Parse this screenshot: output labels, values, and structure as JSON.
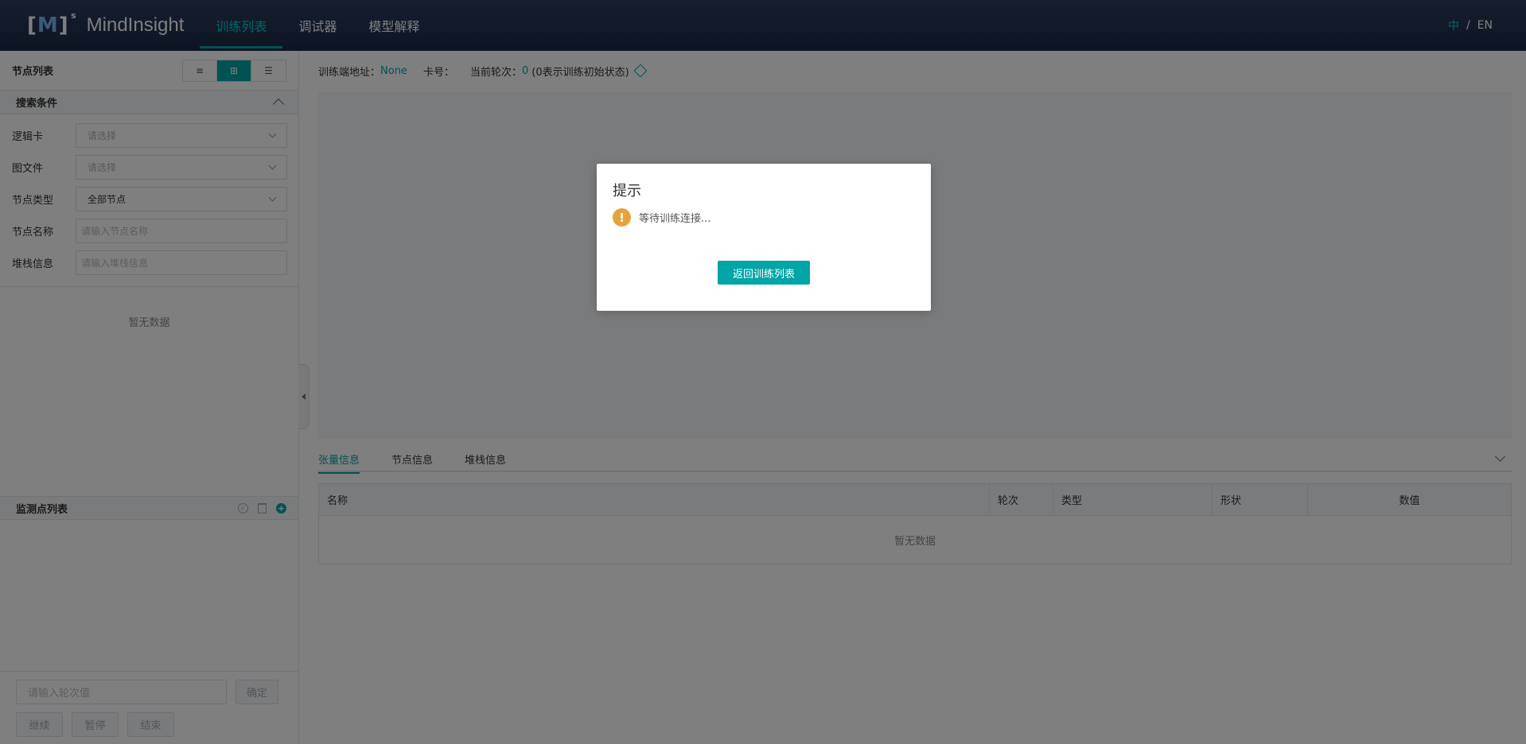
{
  "header": {
    "logo_mark": "M",
    "logo_sup": "s",
    "app_name": "MindInsight",
    "nav": [
      {
        "label": "训练列表",
        "active": true
      },
      {
        "label": "调试器",
        "active": false
      },
      {
        "label": "模型解释",
        "active": false
      }
    ],
    "lang": {
      "zh": "中",
      "sep": "/",
      "en": "EN"
    }
  },
  "left": {
    "node_list_title": "节点列表",
    "view_switch": [
      "≡",
      "⊞",
      "☰"
    ],
    "search": {
      "title": "搜索条件",
      "fields": [
        {
          "label": "逻辑卡",
          "value": "请选择",
          "kind": "select",
          "filled": false
        },
        {
          "label": "图文件",
          "value": "请选择",
          "kind": "select",
          "filled": false
        },
        {
          "label": "节点类型",
          "value": "全部节点",
          "kind": "select",
          "filled": true
        },
        {
          "label": "节点名称",
          "value": "请输入节点名称",
          "kind": "input",
          "filled": false
        },
        {
          "label": "堆栈信息",
          "value": "请输入堆栈信息",
          "kind": "input",
          "filled": false
        }
      ]
    },
    "no_data": "暂无数据",
    "watch_title": "监测点列表",
    "round_placeholder": "请输入轮次值",
    "confirm_label": "确定",
    "controls": [
      "继续",
      "暂停",
      "结束"
    ]
  },
  "info_bar": {
    "address_label": "训练端地址：",
    "address_value": "None",
    "card_label": "卡号：",
    "round_label": "当前轮次：",
    "round_value": "0",
    "round_note": "(0表示训练初始状态)"
  },
  "tabs": [
    "张量信息",
    "节点信息",
    "堆栈信息"
  ],
  "table": {
    "columns": [
      "名称",
      "轮次",
      "类型",
      "形状",
      "数值"
    ],
    "empty": "暂无数据"
  },
  "dialog": {
    "title": "提示",
    "message": "等待训练连接...",
    "button": "返回训练列表"
  },
  "colors": {
    "accent": "#00a5a7",
    "header": "#1b2843",
    "warning": "#e6a23c"
  }
}
